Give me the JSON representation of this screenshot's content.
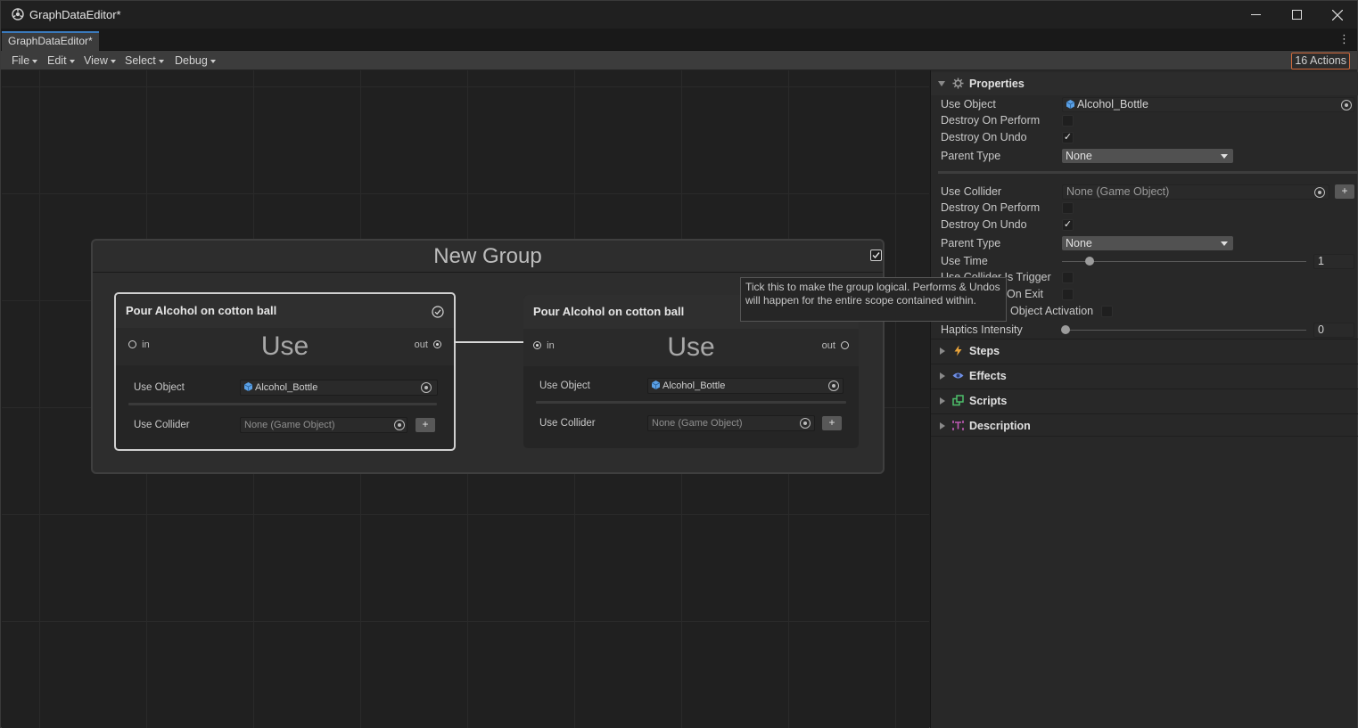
{
  "window": {
    "title": "GraphDataEditor*",
    "tab": "GraphDataEditor*"
  },
  "menus": {
    "file": "File",
    "edit": "Edit",
    "view": "View",
    "select": "Select",
    "debug": "Debug"
  },
  "actions_count": "16 Actions",
  "group": {
    "title": "New Group",
    "logical": true
  },
  "tooltip": "Tick this to make the group logical. Performs & Undos will happen for the entire scope contained within.",
  "nodes": [
    {
      "title": "Pour Alcohol on cotton ball",
      "type": "Use",
      "in_label": "in",
      "out_label": "out",
      "use_object_label": "Use Object",
      "use_object_value": "Alcohol_Bottle",
      "use_collider_label": "Use Collider",
      "use_collider_value": "None (Game Object)",
      "add_label": "+"
    },
    {
      "title": "Pour Alcohol on cotton ball",
      "type": "Use",
      "in_label": "in",
      "out_label": "out",
      "use_object_label": "Use Object",
      "use_object_value": "Alcohol_Bottle",
      "use_collider_label": "Use Collider",
      "use_collider_value": "None (Game Object)",
      "add_label": "+"
    }
  ],
  "inspector": {
    "properties_title": "Properties",
    "use_object_label": "Use Object",
    "use_object_value": "Alcohol_Bottle",
    "destroy_on_perform_label": "Destroy On Perform",
    "destroy_on_undo_label": "Destroy On Undo",
    "parent_type_label": "Parent Type",
    "parent_type_value": "None",
    "use_collider_label": "Use Collider",
    "use_collider_value": "None (Game Object)",
    "add_label": "+",
    "destroy_on_perform_2_label": "Destroy On Perform",
    "destroy_on_undo_2_label": "Destroy On Undo",
    "parent_type_2_label": "Parent Type",
    "parent_type_2_value": "None",
    "use_time_label": "Use Time",
    "use_time_value": "1",
    "is_trigger_label": "Use Collider Is Trigger",
    "on_exit_label": "On Exit",
    "object_activation_label": "Object Activation",
    "haptics_label": "Haptics Intensity",
    "haptics_value": "0",
    "sections": [
      "Steps",
      "Effects",
      "Scripts",
      "Description"
    ]
  },
  "checkmark": "✓",
  "colors": {
    "accent": "#3a79bb",
    "actions_border": "#d16a3b",
    "steps": "#e8a33a",
    "effects": "#6f8fe6",
    "scripts": "#4dbf6a",
    "description": "#c05ab6"
  }
}
